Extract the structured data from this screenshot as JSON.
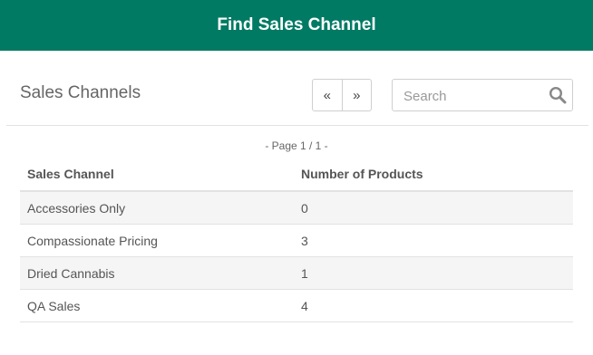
{
  "header": {
    "title": "Find Sales Channel"
  },
  "panel": {
    "title": "Sales Channels",
    "pager": {
      "prev_label": "«",
      "next_label": "»"
    },
    "search": {
      "placeholder": "Search",
      "value": ""
    },
    "page_indicator": "- Page 1 / 1 -"
  },
  "table": {
    "columns": [
      "Sales Channel",
      "Number of Products"
    ],
    "rows": [
      {
        "name": "Accessories Only",
        "count": "0"
      },
      {
        "name": "Compassionate Pricing",
        "count": "3"
      },
      {
        "name": "Dried Cannabis",
        "count": "1"
      },
      {
        "name": "QA Sales",
        "count": "4"
      }
    ]
  },
  "colors": {
    "header_bg": "#007a63",
    "row_stripe": "#f5f5f5"
  }
}
